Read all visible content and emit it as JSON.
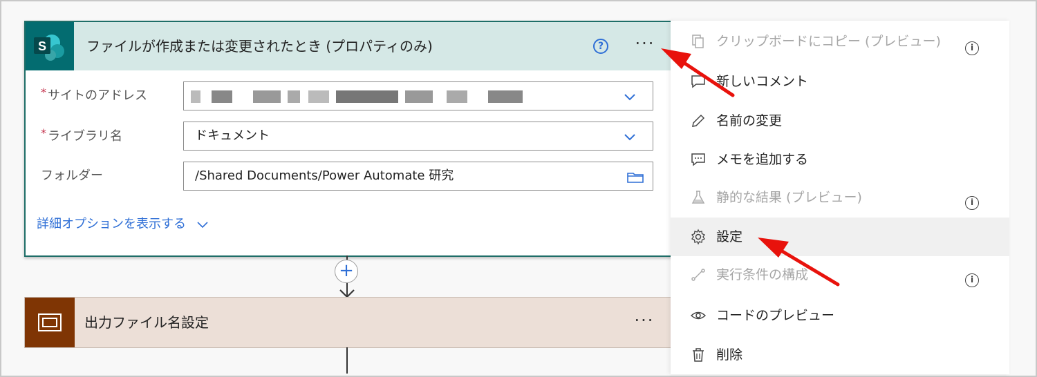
{
  "trigger": {
    "title": "ファイルが作成または変更されたとき (プロパティのみ)",
    "help_icon": "help-circle-icon",
    "more_icon": "ellipsis-icon",
    "more_text": "···",
    "fields": [
      {
        "label": "サイトのアドレス",
        "required": true,
        "value": ""
      },
      {
        "label": "ライブラリ名",
        "required": true,
        "value": "ドキュメント"
      },
      {
        "label": "フォルダー",
        "required": false,
        "value": "/Shared Documents/Power Automate 研究"
      }
    ],
    "advanced_link": "詳細オプションを表示する"
  },
  "add_step": "+",
  "action": {
    "title": "出力ファイル名設定",
    "more_text": "···"
  },
  "menu": {
    "items": [
      {
        "label": "クリップボードにコピー (プレビュー)",
        "icon": "copy-icon",
        "disabled": true,
        "info": true
      },
      {
        "label": "新しいコメント",
        "icon": "comment-icon",
        "disabled": false,
        "info": false
      },
      {
        "label": "名前の変更",
        "icon": "pencil-icon",
        "disabled": false,
        "info": false
      },
      {
        "label": "メモを追加する",
        "icon": "note-icon",
        "disabled": false,
        "info": false
      },
      {
        "label": "静的な結果 (プレビュー)",
        "icon": "flask-icon",
        "disabled": true,
        "info": true
      },
      {
        "label": "設定",
        "icon": "gear-icon",
        "disabled": false,
        "info": false,
        "hover": true
      },
      {
        "label": "実行条件の構成",
        "icon": "run-after-icon",
        "disabled": true,
        "info": true
      },
      {
        "label": "コードのプレビュー",
        "icon": "eye-icon",
        "disabled": false,
        "info": false
      },
      {
        "label": "削除",
        "icon": "trash-icon",
        "disabled": false,
        "info": false
      }
    ],
    "info_text": "i"
  },
  "colors": {
    "trigger_header": "#d5e8e6",
    "trigger_border": "#1e6e68",
    "sharepoint_tile": "#036c70",
    "action_header": "#ecdfd7",
    "action_tile": "#7f3504",
    "link": "#2f6fd6",
    "annotation_arrow": "#e8120c"
  }
}
